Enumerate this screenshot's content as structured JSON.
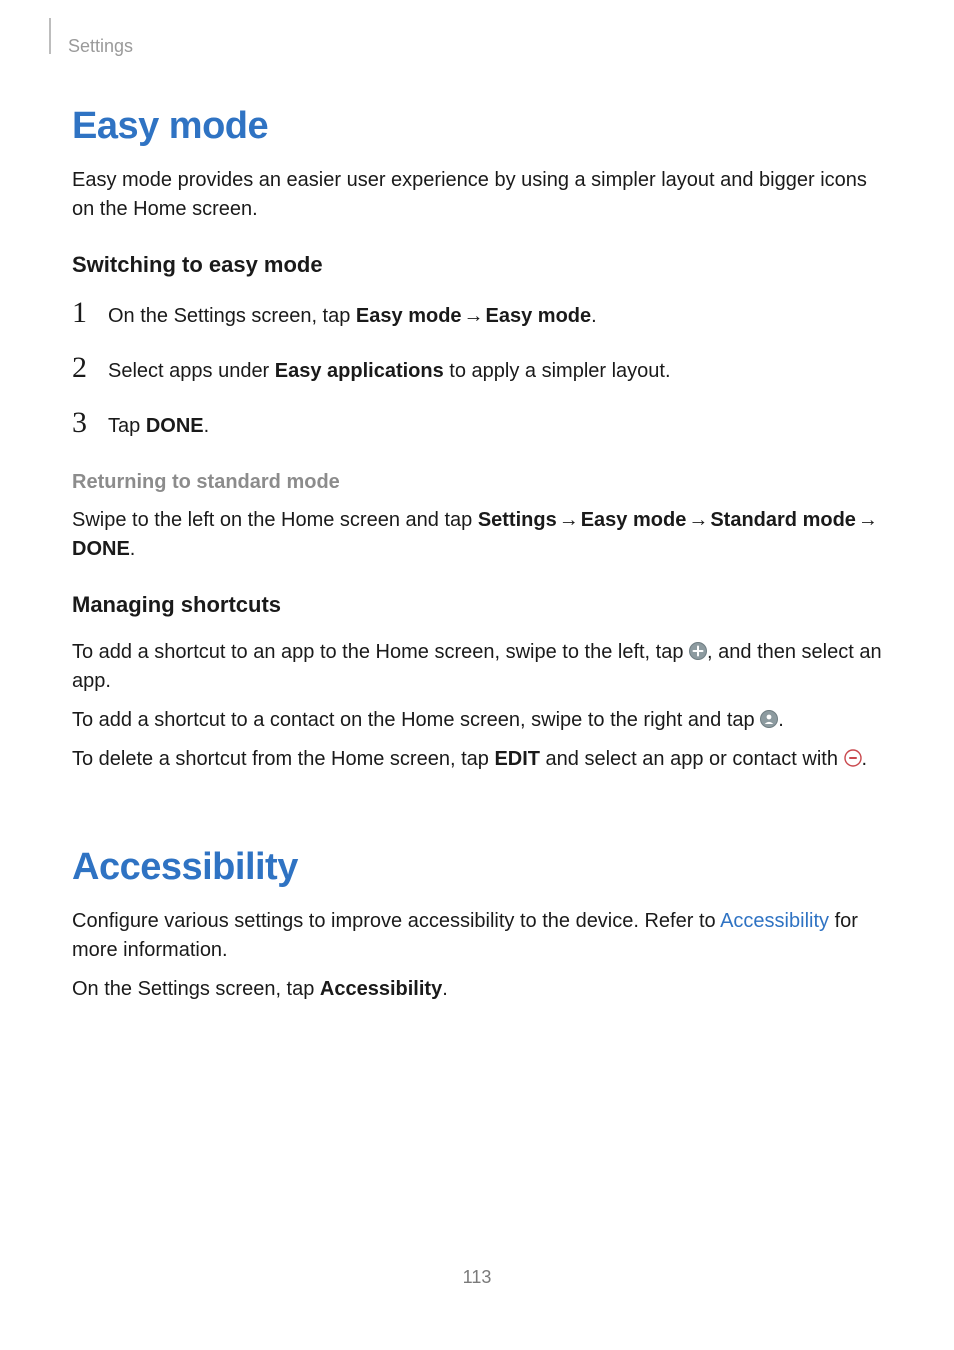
{
  "header": {
    "breadcrumb": "Settings"
  },
  "easyMode": {
    "title": "Easy mode",
    "intro": "Easy mode provides an easier user experience by using a simpler layout and bigger icons on the Home screen.",
    "switching": {
      "heading": "Switching to easy mode",
      "step1": {
        "pre": "On the Settings screen, tap ",
        "bold1": "Easy mode",
        "arrow": " → ",
        "bold2": "Easy mode",
        "post": "."
      },
      "step2": {
        "pre": "Select apps under ",
        "bold": "Easy applications",
        "post": " to apply a simpler layout."
      },
      "step3": {
        "pre": "Tap ",
        "bold": "DONE",
        "post": "."
      }
    },
    "returning": {
      "heading": "Returning to standard mode",
      "pre": "Swipe to the left on the Home screen and tap ",
      "b1": "Settings",
      "a1": " → ",
      "b2": "Easy mode",
      "a2": " → ",
      "b3": "Standard mode",
      "a3": " → ",
      "b4": "DONE",
      "post": "."
    },
    "managing": {
      "heading": "Managing shortcuts",
      "line1": {
        "pre": "To add a shortcut to an app to the Home screen, swipe to the left, tap ",
        "post": ", and then select an app."
      },
      "line2": {
        "pre": "To add a shortcut to a contact on the Home screen, swipe to the right and tap ",
        "post": "."
      },
      "line3": {
        "pre": "To delete a shortcut from the Home screen, tap ",
        "bold": "EDIT",
        "mid": " and select an app or contact with ",
        "post": "."
      }
    }
  },
  "accessibility": {
    "title": "Accessibility",
    "p1": {
      "pre": "Configure various settings to improve accessibility to the device. Refer to ",
      "link": "Accessibility",
      "post": " for more information."
    },
    "p2": {
      "pre": "On the Settings screen, tap ",
      "bold": "Accessibility",
      "post": "."
    }
  },
  "pageNumber": "113"
}
